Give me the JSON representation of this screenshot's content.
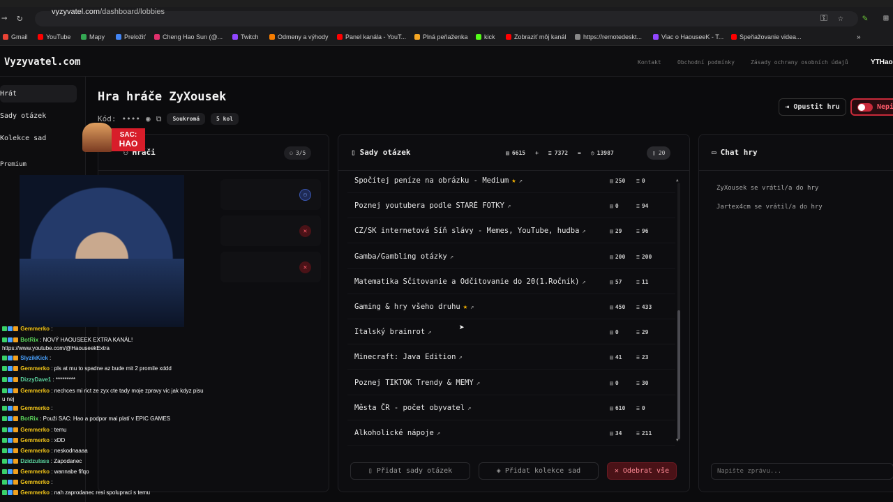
{
  "browser": {
    "url_host": "vyzyvatel.com",
    "url_path": "/dashboard/lobbies",
    "bookmarks": [
      "Gmail",
      "YouTube",
      "Mapy",
      "Preložiť",
      "Cheng Hao Sun (@...",
      "Twitch",
      "Odmeny a výhody",
      "Panel kanála - YouT...",
      "Plná peňaženka",
      "kick",
      "Zobraziť môj kanál",
      "https://remotedeskt...",
      "Viac o HaouseeK - T...",
      "Speňažovanie videa..."
    ]
  },
  "header": {
    "logo": "Vyzyvatel.com",
    "links": [
      "Kontakt",
      "Obchodní podmínky",
      "Zásady ochrany osobních údajů"
    ],
    "user": "YTHaou"
  },
  "sidebar": {
    "items": [
      "Hrát",
      "Sady otázek",
      "Kolekce sad",
      "Premium"
    ]
  },
  "game": {
    "title": "Hra hráče ZyXousek",
    "code_label": "Kód:",
    "code_mask": "••••",
    "privacy": "Soukromá",
    "rounds": "5 kol",
    "leave_label": "Opustit hru",
    "visibility_label": "Nepi"
  },
  "players_panel": {
    "title": "Hráči",
    "count": "3/5"
  },
  "sets_panel": {
    "title": "Sady otázek",
    "total_a": "6615",
    "plus": "+",
    "total_b": "7372",
    "equals": "=",
    "total_sum": "13987",
    "set_count": "20",
    "rows": [
      {
        "name": "Spočítej peníze na obrázku - Medium",
        "star": true,
        "a": "250",
        "b": "0"
      },
      {
        "name": "Poznej youtubera podle STARÉ FOTKY",
        "star": false,
        "a": "0",
        "b": "94"
      },
      {
        "name": "CZ/SK internetová Síň slávy - Memes, YouTube, hudba",
        "star": false,
        "a": "29",
        "b": "96"
      },
      {
        "name": "Gamba/Gambling otázky",
        "star": false,
        "a": "200",
        "b": "200"
      },
      {
        "name": "Matematika Sčitovanie a Odčitovanie do 20(1.Ročník)",
        "star": false,
        "a": "57",
        "b": "11"
      },
      {
        "name": "Gaming & hry všeho druhu",
        "star": true,
        "a": "450",
        "b": "433"
      },
      {
        "name": "Italský brainrot",
        "star": false,
        "a": "0",
        "b": "29"
      },
      {
        "name": "Minecraft: Java Edition",
        "star": false,
        "a": "41",
        "b": "23"
      },
      {
        "name": "Poznej TIKTOK Trendy & MEMY",
        "star": false,
        "a": "0",
        "b": "30"
      },
      {
        "name": "Města ČR - počet obyvatel",
        "star": false,
        "a": "610",
        "b": "0"
      },
      {
        "name": "Alkoholické nápoje",
        "star": false,
        "a": "34",
        "b": "211"
      }
    ],
    "add_sets": "Přidat sady otázek",
    "add_collections": "Přidat kolekce sad",
    "remove_all": "Odebrat vše"
  },
  "chat_panel": {
    "title": "Chat hry",
    "messages": [
      "ZyXousek se vrátil/a do hry",
      "Jartex4cm se vrátil/a do hry"
    ],
    "input_placeholder": "Napište zprávu..."
  },
  "overlay": {
    "sac_line1": "SAC:",
    "sac_line2": "HAO",
    "chat": [
      {
        "user": "Gemmerko",
        "color": "#f0c419",
        "text": " : "
      },
      {
        "user": "BotRix",
        "color": "#5cd65c",
        "text": " : NOVÝ HAOUSEEK EXTRA KANÁL! https://www.youtube.com/@HaouseekExtra"
      },
      {
        "user": "SlyzikKick",
        "color": "#4aa3ff",
        "text": " : "
      },
      {
        "user": "Gemmerko",
        "color": "#f0c419",
        "text": " : pls at mu to spadne az bude mit 2 promile xddd"
      },
      {
        "user": "DizzyDave1",
        "color": "#5cd6a0",
        "text": " : *********"
      },
      {
        "user": "Gemmerko",
        "color": "#f0c419",
        "text": " : nechces mi rict ze zyx cte tady moje zpravy vic jak kdyz pisu u nej"
      },
      {
        "user": "Gemmerko",
        "color": "#f0c419",
        "text": " : "
      },
      {
        "user": "BotRix",
        "color": "#5cd65c",
        "text": " : Použi SAC: Hao a podpor mai platí v EPIC GAMES"
      },
      {
        "user": "Gemmerko",
        "color": "#f0c419",
        "text": " : temu"
      },
      {
        "user": "Gemmerko",
        "color": "#f0c419",
        "text": " : xDD"
      },
      {
        "user": "Gemmerko",
        "color": "#f0c419",
        "text": " : neskodnaaaa"
      },
      {
        "user": "Dzidzulass",
        "color": "#5cd6a0",
        "text": " : Zapodanec"
      },
      {
        "user": "Gemmerko",
        "color": "#f0c419",
        "text": " : wannabe fifqo"
      },
      {
        "user": "Gemmerko",
        "color": "#f0c419",
        "text": " : "
      },
      {
        "user": "Gemmerko",
        "color": "#f0c419",
        "text": " : nah zaprodanec resi spolupraci s temu"
      }
    ]
  }
}
